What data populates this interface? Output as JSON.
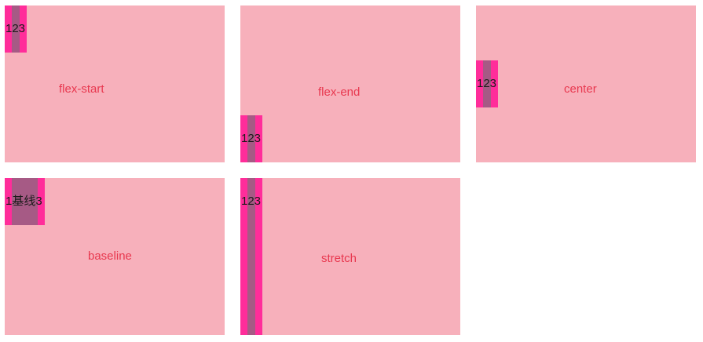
{
  "panels": [
    {
      "label": "flex-start",
      "item_text": "123"
    },
    {
      "label": "flex-end",
      "item_text": "123"
    },
    {
      "label": "center",
      "item_text": "123"
    },
    {
      "label": "baseline",
      "item_text": "1基线3"
    },
    {
      "label": "stretch",
      "item_text": "123"
    }
  ],
  "colors": {
    "panel_bg": "#f7b0bb",
    "label_text": "#e8384f",
    "item_core": "#a65a85",
    "item_edge": "#ff2d9a"
  }
}
